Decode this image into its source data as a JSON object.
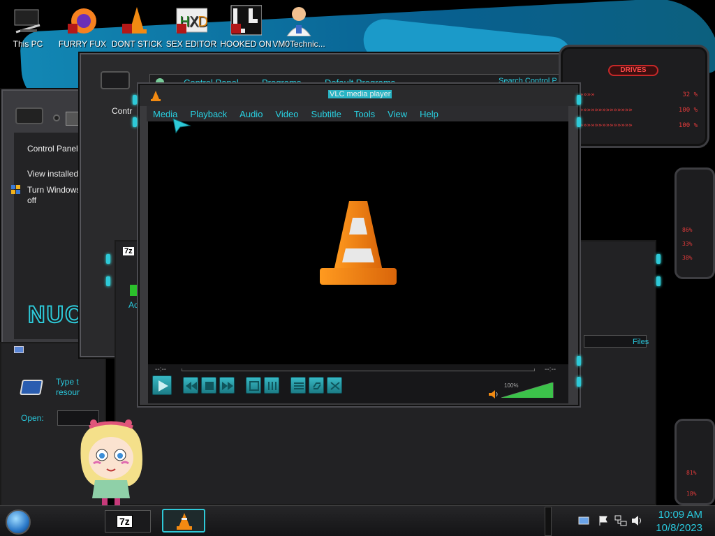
{
  "desktop_icons": [
    {
      "label": "This PC",
      "icon": "computer-icon"
    },
    {
      "label": "FURRY FUX",
      "icon": "firefox-shortcut-icon"
    },
    {
      "label": "DONT STICK",
      "icon": "vlc-shortcut-icon"
    },
    {
      "label": "SEX EDITOR",
      "icon": "hxd-shortcut-icon"
    },
    {
      "label": "HOOKED ON",
      "icon": "app-shortcut-icon"
    },
    {
      "label": "VM0Technic...",
      "icon": "doctor-user-icon"
    }
  ],
  "explorer": {
    "breadcrumb": [
      "Control Panel",
      "Programs",
      "Default Programs"
    ],
    "search_placeholder": "Search Control P...",
    "back_title": "Contr"
  },
  "control_panel": {
    "sidebar": [
      "Control Panel",
      "View installed",
      "Turn Windows",
      "off"
    ]
  },
  "run_dialog": {
    "prompt": "Type t\nresour",
    "open_label": "Open:"
  },
  "sevenzip": {
    "badge": "7z",
    "add_label": "Ac",
    "files_label": "Files"
  },
  "wallpaper_text": "NUCL",
  "vlc": {
    "title": "VLC media player",
    "menu": [
      "Media",
      "Playback",
      "Audio",
      "Video",
      "Subtitle",
      "Tools",
      "View",
      "Help"
    ],
    "time_elapsed": "--:--",
    "time_total": "--:--",
    "volume": "100%",
    "volume_level": 1.0,
    "buttons": [
      "play-icon",
      "prev-icon",
      "stop-icon",
      "next-icon",
      "fullscreen-icon",
      "extended-settings-icon",
      "playlist-icon",
      "loop-icon",
      "random-icon"
    ]
  },
  "drives_gadget": {
    "title": "DRIVES",
    "rows": [
      {
        "bar": "»»»»»»",
        "pct": "32 %"
      },
      {
        "bar": "»»»»»»»»»»»»»»»»",
        "pct": "100 %"
      },
      {
        "bar": "»»»»»»»»»»»»»»»»",
        "pct": "100 %"
      }
    ],
    "side_readouts": [
      "86%",
      "33%",
      "38%"
    ],
    "lower_readouts": [
      "81%",
      "18%"
    ]
  },
  "taskbar": {
    "tasks": [
      {
        "label": "7z",
        "icon": "7zip-icon"
      },
      {
        "label": "",
        "icon": "vlc-icon"
      }
    ],
    "tray_icons": [
      "network-flyout-icon",
      "action-center-flag-icon",
      "network-icon",
      "speaker-icon"
    ],
    "time": "10:09 AM",
    "date": "10/8/2023"
  },
  "colors": {
    "accent_cyan": "#29d2e3",
    "vlc_orange": "#f28a12",
    "drive_red": "#e53b3b"
  }
}
